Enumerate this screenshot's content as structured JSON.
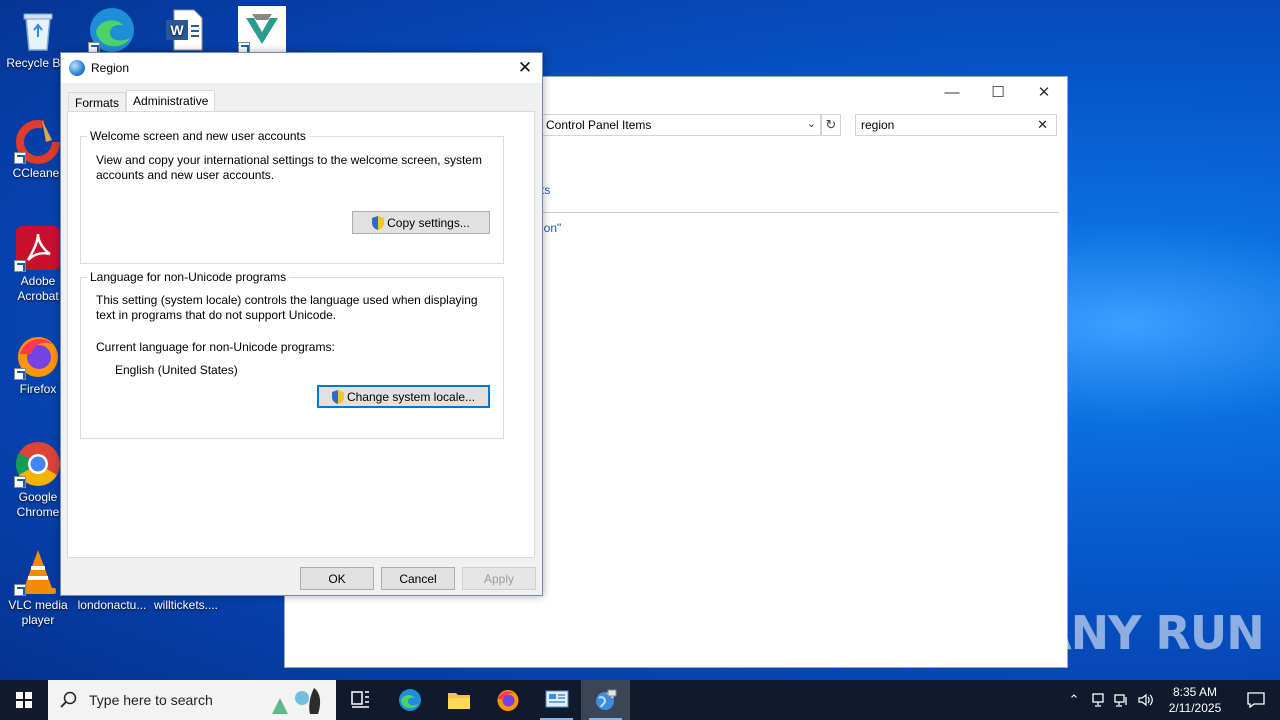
{
  "desktop": {
    "icons": [
      {
        "label": "Recycle Bin"
      },
      {
        "label": "CCleaner"
      },
      {
        "label": "Adobe Acrobat"
      },
      {
        "label": "Firefox"
      },
      {
        "label": "Google Chrome"
      },
      {
        "label": "VLC media player"
      },
      {
        "label": "londonactu..."
      },
      {
        "label": "willtickets...."
      }
    ]
  },
  "control_panel": {
    "address": "Control Panel Items",
    "search_value": "region",
    "link1": "ts",
    "link2": "ion\""
  },
  "dialog": {
    "title": "Region",
    "tabs": [
      "Formats",
      "Administrative"
    ],
    "active_tab": "Administrative",
    "welcome_group": {
      "legend": "Welcome screen and new user accounts",
      "description": "View and copy your international settings to the welcome screen, system accounts and new user accounts.",
      "button": "Copy settings..."
    },
    "locale_group": {
      "legend": "Language for non-Unicode programs",
      "description": "This setting (system locale) controls the language used when displaying text in programs that do not support Unicode.",
      "current_label": "Current language for non-Unicode programs:",
      "current_value": "English (United States)",
      "button": "Change system locale..."
    },
    "ok": "OK",
    "cancel": "Cancel",
    "apply": "Apply"
  },
  "taskbar": {
    "search_placeholder": "Type here to search",
    "time": "8:35 AM",
    "date": "2/11/2025"
  },
  "watermark": "ANY RUN"
}
